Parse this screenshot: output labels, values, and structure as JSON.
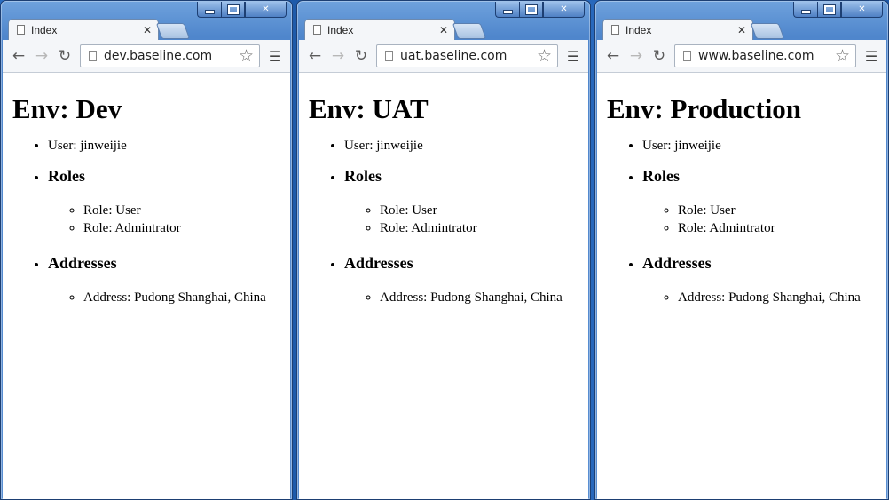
{
  "windows": [
    {
      "tab_title": "Index",
      "url": "dev.baseline.com",
      "heading": "Env: Dev",
      "user_item": "User: jinweijie",
      "roles_heading": "Roles",
      "roles": [
        "Role: User",
        "Role: Admintrator"
      ],
      "addresses_heading": "Addresses",
      "addresses": [
        "Address: Pudong Shanghai, China"
      ]
    },
    {
      "tab_title": "Index",
      "url": "uat.baseline.com",
      "heading": "Env: UAT",
      "user_item": "User: jinweijie",
      "roles_heading": "Roles",
      "roles": [
        "Role: User",
        "Role: Admintrator"
      ],
      "addresses_heading": "Addresses",
      "addresses": [
        "Address: Pudong Shanghai, China"
      ]
    },
    {
      "tab_title": "Index",
      "url": "www.baseline.com",
      "heading": "Env: Production",
      "user_item": "User: jinweijie",
      "roles_heading": "Roles",
      "roles": [
        "Role: User",
        "Role: Admintrator"
      ],
      "addresses_heading": "Addresses",
      "addresses": [
        "Address: Pudong Shanghai, China"
      ]
    }
  ],
  "icons": {
    "back": "back-arrow-icon",
    "forward": "forward-arrow-icon",
    "reload": "reload-icon",
    "page": "page-icon",
    "star": "star-icon",
    "menu": "hamburger-menu-icon",
    "close_tab": "close-icon",
    "minimize": "minimize-icon",
    "maximize": "maximize-icon",
    "close_window": "close-window-icon"
  },
  "colors": {
    "window_frame": "#4f86cc",
    "desktop": "#1e5fae"
  }
}
